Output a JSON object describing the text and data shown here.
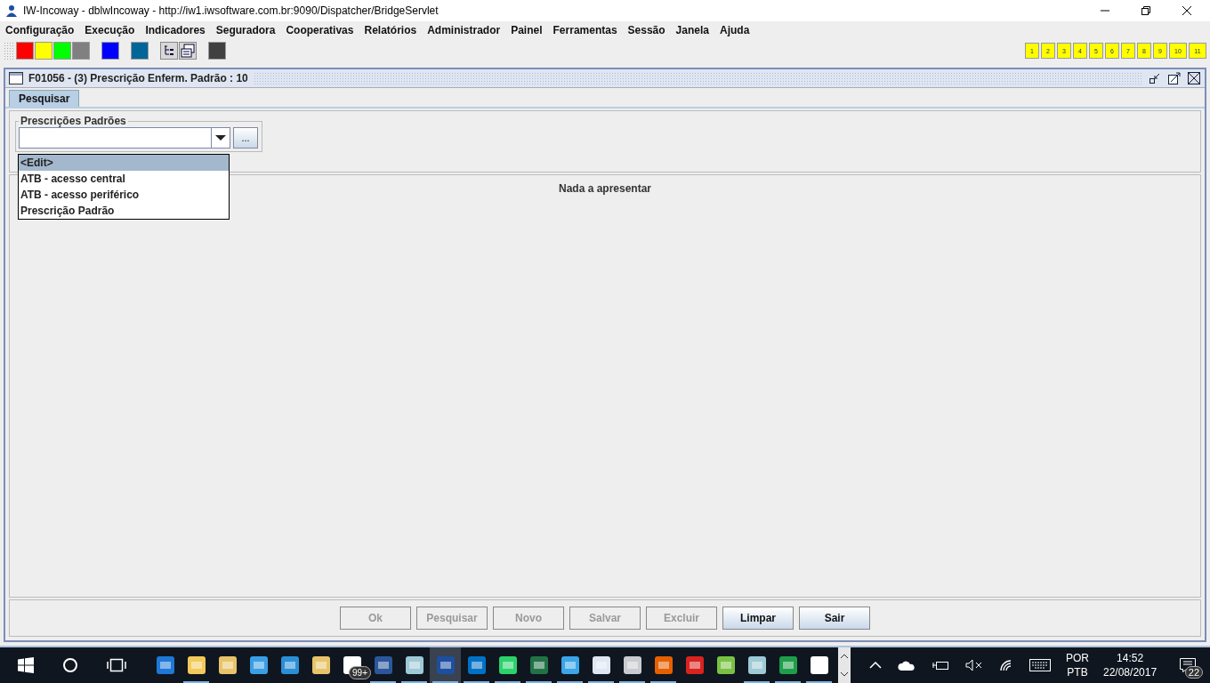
{
  "window": {
    "title": "IW-Incoway - dblwIncoway - http://iw1.iwsoftware.com.br:9090/Dispatcher/BridgeServlet"
  },
  "menu": [
    "Configuração",
    "Execução",
    "Indicadores",
    "Seguradora",
    "Cooperativas",
    "Relatórios",
    "Administrador",
    "Painel",
    "Ferramentas",
    "Sessão",
    "Janela",
    "Ajuda"
  ],
  "toolbar": [
    {
      "kind": "swatch",
      "color": "#ff0000"
    },
    {
      "kind": "swatch",
      "color": "#ffff00"
    },
    {
      "kind": "swatch",
      "color": "#00ff00"
    },
    {
      "kind": "swatch",
      "color": "#808080"
    },
    {
      "kind": "gap"
    },
    {
      "kind": "swatch",
      "color": "#0000ff"
    },
    {
      "kind": "gap"
    },
    {
      "kind": "swatch",
      "color": "#006699"
    },
    {
      "kind": "gap"
    },
    {
      "kind": "tree"
    },
    {
      "kind": "windows"
    },
    {
      "kind": "gap"
    },
    {
      "kind": "swatch",
      "color": "#404040"
    }
  ],
  "window_buttons": [
    "1",
    "2",
    "3",
    "4",
    "5",
    "6",
    "7",
    "8",
    "9",
    "10",
    "11"
  ],
  "frame": {
    "title": "F01056 - (3) Prescrição Enferm. Padrão : 10",
    "tabs": [
      {
        "label": "Pesquisar",
        "selected": true
      }
    ],
    "group": {
      "legend": "Prescrições Padrões",
      "browse_button": "...",
      "options": [
        {
          "label": "<Edit>",
          "selected": true
        },
        {
          "label": "ATB - acesso central",
          "selected": false
        },
        {
          "label": "ATB - acesso periférico",
          "selected": false
        },
        {
          "label": "Prescrição Padrão",
          "selected": false
        }
      ]
    },
    "empty_message": "Nada a apresentar",
    "buttons": [
      {
        "label": "Ok",
        "disabled": true
      },
      {
        "label": "Pesquisar",
        "disabled": true
      },
      {
        "label": "Novo",
        "disabled": true
      },
      {
        "label": "Salvar",
        "disabled": true
      },
      {
        "label": "Excluir",
        "disabled": true
      },
      {
        "label": "Limpar",
        "disabled": false
      },
      {
        "label": "Sair",
        "disabled": false
      }
    ]
  },
  "taskbar": {
    "apps": [
      {
        "kind": "edge",
        "open": false,
        "active": false
      },
      {
        "kind": "folder",
        "open": true,
        "active": false
      },
      {
        "kind": "docs",
        "open": false,
        "active": false
      },
      {
        "kind": "pc",
        "open": false,
        "active": false
      },
      {
        "kind": "chart",
        "open": false,
        "active": false
      },
      {
        "kind": "folder-img",
        "open": false,
        "active": false
      },
      {
        "kind": "mail",
        "open": false,
        "active": false,
        "badge": "99+"
      },
      {
        "kind": "word",
        "open": true,
        "active": false
      },
      {
        "kind": "notepad",
        "open": true,
        "active": false
      },
      {
        "kind": "iw",
        "open": true,
        "active": true
      },
      {
        "kind": "outlook",
        "open": true,
        "active": false
      },
      {
        "kind": "vs",
        "open": true,
        "active": false
      },
      {
        "kind": "excel",
        "open": true,
        "active": false
      },
      {
        "kind": "ie",
        "open": true,
        "active": false
      },
      {
        "kind": "doc",
        "open": true,
        "active": false
      },
      {
        "kind": "monitor",
        "open": true,
        "active": false
      },
      {
        "kind": "firefox",
        "open": true,
        "active": false
      },
      {
        "kind": "shield",
        "open": false,
        "active": false
      },
      {
        "kind": "leaf",
        "open": false,
        "active": false
      },
      {
        "kind": "notepad",
        "open": true,
        "active": false
      },
      {
        "kind": "sheet",
        "open": true,
        "active": false
      },
      {
        "kind": "photo",
        "open": true,
        "active": false
      }
    ],
    "language": "POR",
    "layout": "PTB",
    "time": "14:52",
    "date": "22/08/2017",
    "notifications": "22"
  }
}
